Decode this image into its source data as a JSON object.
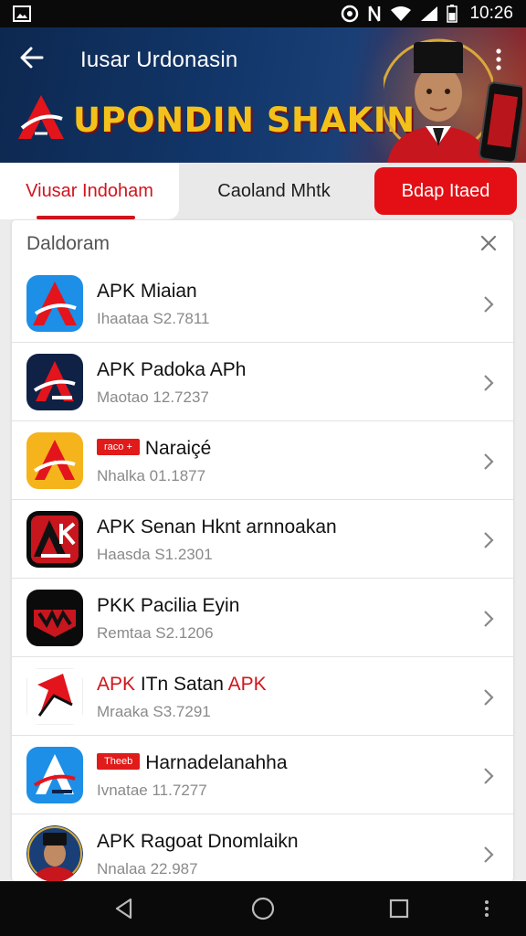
{
  "status_bar": {
    "time": "10:26"
  },
  "header": {
    "title": "Iusar Urdonasin",
    "banner_text": "UPONDIN SHAKIN"
  },
  "tabs": [
    {
      "label": "Viusar Indoham"
    },
    {
      "label": "Caoland Mhtk"
    },
    {
      "label": "Bdap Itaed"
    }
  ],
  "panel": {
    "title": "Daldoram",
    "items": [
      {
        "name": "APK Miaian",
        "sub": "Ihaataa S2.7811"
      },
      {
        "name": "APK Padoka APh",
        "sub": "Maotao 12.7237"
      },
      {
        "badge": "raco  +",
        "name": "Naraiçé",
        "sub": "Nhalka 01.1877"
      },
      {
        "name": "APK Senan Hknt arnnoakan",
        "sub": "Haasda S1.2301"
      },
      {
        "name": "PKK Pacilia Eyin",
        "sub": "Remtaa S2.1206"
      },
      {
        "name_red_1": "APK",
        "name_mid": " ITn Satan ",
        "name_red_2": "APK",
        "sub": "Mraaka S3.7291"
      },
      {
        "badge": "Theeb",
        "name": "Harnadelanahha",
        "sub": "Ivnatae 11.7277"
      },
      {
        "name": "APK Ragoat Dnomlaikn",
        "sub": "Nnalaa 22.987"
      }
    ]
  },
  "colors": {
    "accent_red": "#e30f15",
    "header_blue": "#12376b",
    "banner_gold": "#f3c21a"
  }
}
